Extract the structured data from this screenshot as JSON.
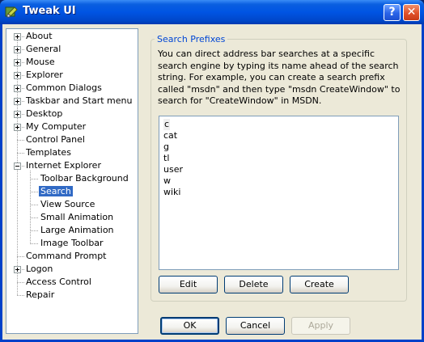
{
  "window": {
    "title": "Tweak UI",
    "help_glyph": "?",
    "close_glyph": "✕"
  },
  "tree": {
    "items": [
      {
        "label": "About",
        "expander": "+"
      },
      {
        "label": "General",
        "expander": "+"
      },
      {
        "label": "Mouse",
        "expander": "+"
      },
      {
        "label": "Explorer",
        "expander": "+"
      },
      {
        "label": "Common Dialogs",
        "expander": "+"
      },
      {
        "label": "Taskbar and Start menu",
        "expander": "+"
      },
      {
        "label": "Desktop",
        "expander": "+"
      },
      {
        "label": "My Computer",
        "expander": "+"
      },
      {
        "label": "Control Panel",
        "expander": ""
      },
      {
        "label": "Templates",
        "expander": ""
      },
      {
        "label": "Internet Explorer",
        "expander": "-"
      },
      {
        "label": "Toolbar Background",
        "expander": ""
      },
      {
        "label": "Search",
        "expander": ""
      },
      {
        "label": "View Source",
        "expander": ""
      },
      {
        "label": "Small Animation",
        "expander": ""
      },
      {
        "label": "Large Animation",
        "expander": ""
      },
      {
        "label": "Image Toolbar",
        "expander": ""
      },
      {
        "label": "Command Prompt",
        "expander": ""
      },
      {
        "label": "Logon",
        "expander": "+"
      },
      {
        "label": "Access Control",
        "expander": ""
      },
      {
        "label": "Repair",
        "expander": ""
      }
    ],
    "selected": "Search"
  },
  "search_prefixes": {
    "title": "Search Prefixes",
    "description": "You can direct address bar searches at a specific search engine by typing its name ahead of the search string. For example, you can create a search prefix called \"msdn\" and then type \"msdn CreateWindow\" to search for \"CreateWindow\" in MSDN.",
    "prefixes": [
      "c",
      "cat",
      "g",
      "tl",
      "user",
      "w",
      "wiki"
    ],
    "focused": "c",
    "buttons": {
      "edit": "Edit",
      "delete": "Delete",
      "create": "Create"
    }
  },
  "dialog_buttons": {
    "ok": "OK",
    "cancel": "Cancel",
    "apply": "Apply"
  },
  "colors": {
    "title_blue": "#0054e3",
    "selection": "#316ac5",
    "group_title": "#0046d5",
    "face": "#ece9d8"
  }
}
